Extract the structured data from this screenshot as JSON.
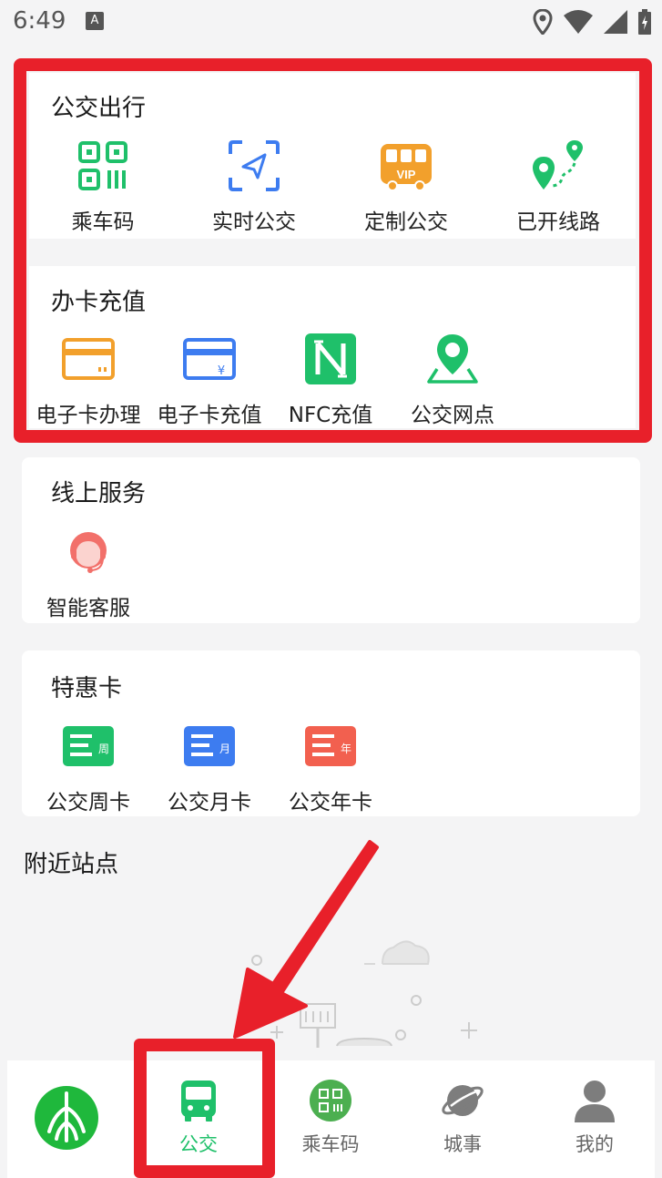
{
  "status_bar": {
    "time": "6:49",
    "notif_letter": "A"
  },
  "transit": {
    "title": "公交出行",
    "items": [
      {
        "label": "乘车码",
        "icon": "qr-code-icon"
      },
      {
        "label": "实时公交",
        "icon": "navigation-arrow-icon"
      },
      {
        "label": "定制公交",
        "icon": "vip-bus-icon"
      },
      {
        "label": "已开线路",
        "icon": "route-pin-icon"
      }
    ]
  },
  "card_recharge": {
    "title": "办卡充值",
    "items": [
      {
        "label": "电子卡办理",
        "icon": "card-icon"
      },
      {
        "label": "电子卡充值",
        "icon": "card-yuan-icon"
      },
      {
        "label": "NFC充值",
        "icon": "nfc-icon"
      },
      {
        "label": "公交网点",
        "icon": "location-pin-icon"
      }
    ]
  },
  "online_service": {
    "title": "线上服务",
    "items": [
      {
        "label": "智能客服",
        "icon": "customer-service-icon"
      }
    ]
  },
  "discount_card": {
    "title": "特惠卡",
    "items": [
      {
        "label": "公交周卡",
        "icon": "week-card-icon",
        "tag": "周"
      },
      {
        "label": "公交月卡",
        "icon": "month-card-icon",
        "tag": "月"
      },
      {
        "label": "公交年卡",
        "icon": "year-card-icon",
        "tag": "年"
      }
    ]
  },
  "nearby": {
    "title": "附近站点"
  },
  "bottom_nav": {
    "items": [
      {
        "label": "",
        "icon": "app-logo-icon"
      },
      {
        "label": "公交",
        "icon": "bus-icon",
        "active": true
      },
      {
        "label": "乘车码",
        "icon": "qr-code-icon"
      },
      {
        "label": "城事",
        "icon": "planet-icon"
      },
      {
        "label": "我的",
        "icon": "user-icon"
      }
    ]
  },
  "colors": {
    "accent_green": "#1fc06a",
    "highlight_red": "#e8202a",
    "blue": "#3d7cf0",
    "orange": "#f2a02c",
    "red_card": "#f2604f"
  }
}
